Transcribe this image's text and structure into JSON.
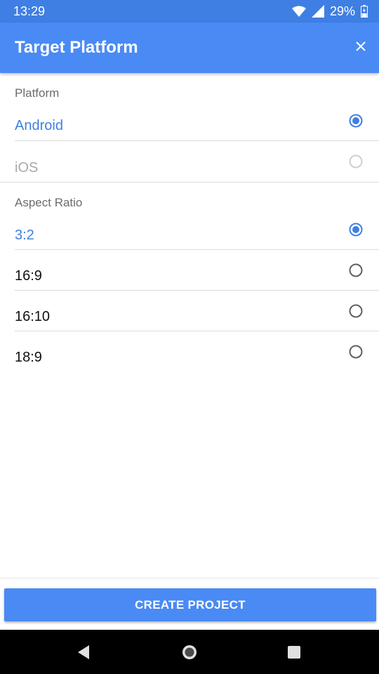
{
  "status_bar": {
    "time": "13:29",
    "battery": "29%"
  },
  "app_bar": {
    "title": "Target Platform"
  },
  "platform": {
    "label": "Platform",
    "options": [
      {
        "label": "Android",
        "selected": true,
        "enabled": true
      },
      {
        "label": "iOS",
        "selected": false,
        "enabled": false
      }
    ]
  },
  "aspect_ratio": {
    "label": "Aspect Ratio",
    "options": [
      {
        "label": "3:2",
        "selected": true
      },
      {
        "label": "16:9",
        "selected": false
      },
      {
        "label": "16:10",
        "selected": false
      },
      {
        "label": "18:9",
        "selected": false
      }
    ]
  },
  "actions": {
    "create_label": "CREATE PROJECT"
  },
  "colors": {
    "primary": "#4a8af4",
    "status_bar": "#3f7fe3",
    "selected_text": "#3f7fe3",
    "disabled_text": "#a8a8a8"
  }
}
